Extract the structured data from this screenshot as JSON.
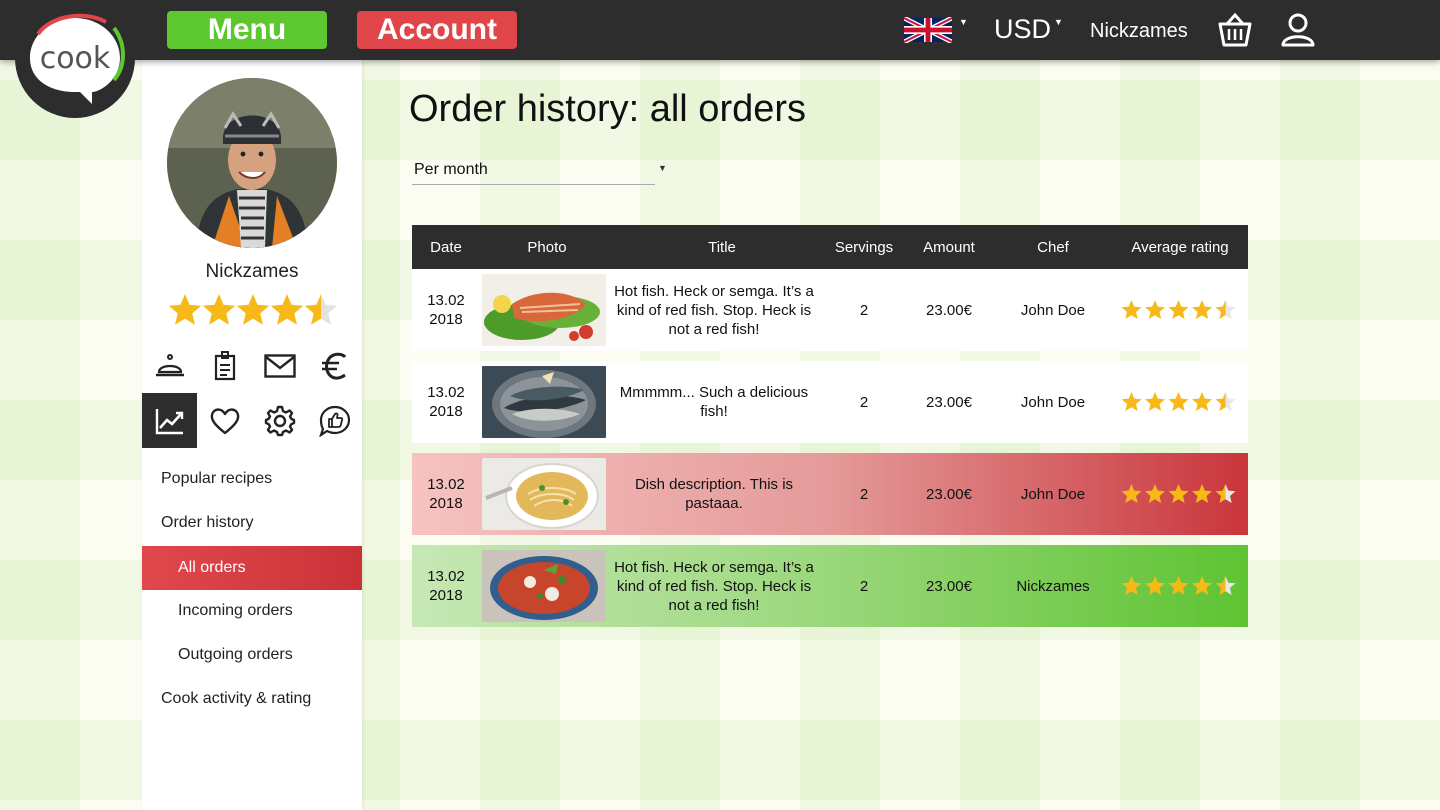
{
  "topbar": {
    "menu_label": "Menu",
    "account_label": "Account",
    "language_icon": "uk-flag-icon",
    "currency": "USD",
    "username": "Nickzames",
    "basket_icon": "basket-icon",
    "user_icon": "user-icon"
  },
  "logo": {
    "text": "cook"
  },
  "profile": {
    "name": "Nickzames",
    "rating": 4.5
  },
  "profile_icons": [
    "cloche-icon",
    "document-icon",
    "mail-icon",
    "euro-icon",
    "chart-icon",
    "heart-icon",
    "gear-icon",
    "chat-like-icon"
  ],
  "sidebar": {
    "items": [
      {
        "label": "Popular recipes",
        "level": 1
      },
      {
        "label": "Order history",
        "level": 1
      },
      {
        "label": "All orders",
        "level": 2,
        "active": true
      },
      {
        "label": "Incoming orders",
        "level": 2
      },
      {
        "label": "Outgoing orders",
        "level": 2
      },
      {
        "label": "Cook activity & rating",
        "level": 1
      }
    ]
  },
  "main": {
    "title": "Order history: all orders",
    "period_select": "Per month"
  },
  "table": {
    "headers": [
      "Date",
      "Photo",
      "Title",
      "Servings",
      "Amount",
      "Chef",
      "Average rating"
    ],
    "rows": [
      {
        "date_day": "13.02",
        "date_year": "2018",
        "title": "Hot fish. Heck or semga. It’s a kind of red fish. Stop. Heck is not a red fish!",
        "servings": "2",
        "amount": "23.00€",
        "chef": "John Doe",
        "rating": 4.5,
        "style": "white"
      },
      {
        "date_day": "13.02",
        "date_year": "2018",
        "title": "Mmmmm... Such a delicious fish!",
        "servings": "2",
        "amount": "23.00€",
        "chef": "John Doe",
        "rating": 4.5,
        "style": "white"
      },
      {
        "date_day": "13.02",
        "date_year": "2018",
        "title": "Dish description. This is pastaaa.",
        "servings": "2",
        "amount": "23.00€",
        "chef": "John Doe",
        "rating": 4.5,
        "style": "red"
      },
      {
        "date_day": "13.02",
        "date_year": "2018",
        "title": "Hot fish. Heck or semga. It’s a kind of red fish. Stop. Heck is not a red fish!",
        "servings": "2",
        "amount": "23.00€",
        "chef": "Nickzames",
        "rating": 4.5,
        "style": "green"
      }
    ]
  },
  "colors": {
    "menu_green": "#5cc72e",
    "account_red": "#e0454a",
    "star": "#f6b918",
    "topbar": "#2d2d2d"
  }
}
